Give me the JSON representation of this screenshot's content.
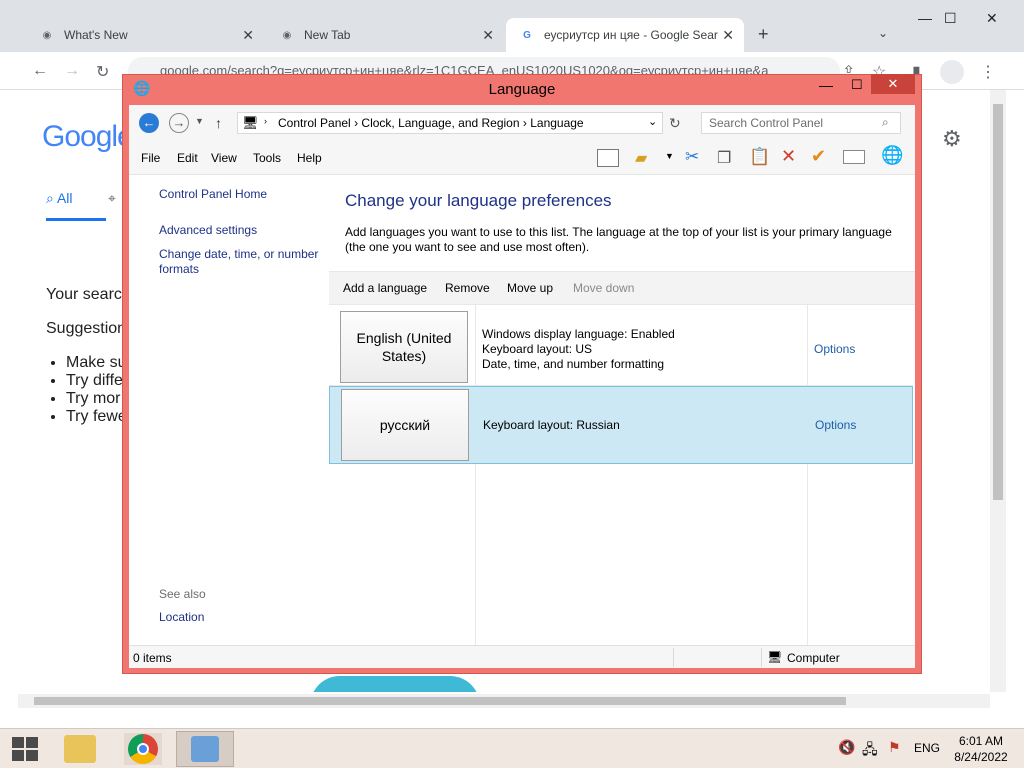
{
  "browser": {
    "tabs": [
      {
        "label": "What's New",
        "active": false
      },
      {
        "label": "New Tab",
        "active": false
      },
      {
        "label": "еусриутср ин цяе - Google Sear",
        "active": true
      }
    ],
    "new_tab_label": "+",
    "url": "google.com/search?q=еусриутср+ин+цяе&rlz=1C1GCEA_enUS1020US1020&oq=еусриутср+ин+цяе&a",
    "page": {
      "logo": "Google",
      "tab_all": "All",
      "your_search": "Your searc",
      "suggestions": "Suggestion",
      "bullets": [
        "Make su",
        "Try diffe",
        "Try mor",
        "Try fewe"
      ]
    }
  },
  "cp": {
    "title": "Language",
    "breadcrumb": [
      "Control Panel",
      "Clock, Language, and Region",
      "Language"
    ],
    "search_placeholder": "Search Control Panel",
    "menu": [
      "File",
      "Edit",
      "View",
      "Tools",
      "Help"
    ],
    "nav": {
      "home": "Control Panel Home",
      "advanced": "Advanced settings",
      "change_date": "Change date, time, or number formats",
      "see_also": "See also",
      "location": "Location"
    },
    "heading": "Change your language preferences",
    "description": "Add languages you want to use to this list. The language at the top of your list is your primary language (the one you want to see and use most often).",
    "commands": {
      "add": "Add a language",
      "remove": "Remove",
      "up": "Move up",
      "down": "Move down"
    },
    "languages": [
      {
        "name": "English (United States)",
        "info": [
          "Windows display language: Enabled",
          "Keyboard layout: US",
          "Date, time, and number formatting"
        ],
        "options": "Options"
      },
      {
        "name": "русский",
        "info": [
          "Keyboard layout: Russian"
        ],
        "options": "Options"
      }
    ],
    "status": {
      "items": "0 items",
      "location": "Computer"
    }
  },
  "taskbar": {
    "lang": "ENG",
    "time": "6:01 AM",
    "date": "8/24/2022"
  },
  "colors": {
    "accent": "#1e3287",
    "window_frame": "#f1766f",
    "selection": "#cce8f4"
  }
}
